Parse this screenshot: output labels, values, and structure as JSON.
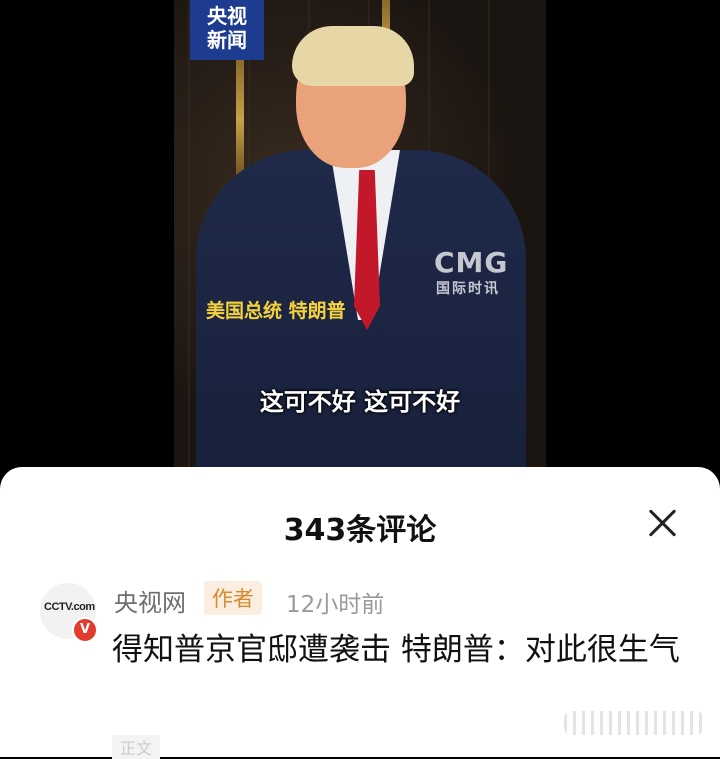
{
  "video": {
    "channel_badge_line1": "央视",
    "channel_badge_line2": "新闻",
    "watermark": "CMG",
    "watermark_sub": "国际时讯",
    "name_caption": "美国总统 特朗普",
    "subtitle": "这可不好 这可不好"
  },
  "comments_sheet": {
    "title": "343条评论",
    "close_icon": "close-icon",
    "comments": [
      {
        "avatar_text": "CCTV.com",
        "verified_badge": "V",
        "author": "央视网",
        "tag": "作者",
        "time": "12小时前",
        "text": "得知普京官邸遭袭击 特朗普：对此很生气",
        "footer_peek": "正文"
      }
    ]
  }
}
